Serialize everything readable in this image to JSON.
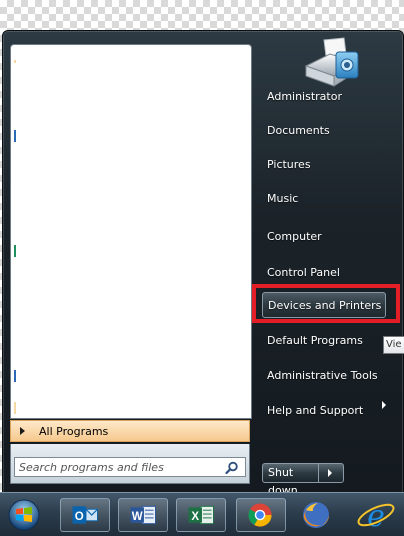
{
  "start_menu": {
    "all_programs_label": "All Programs",
    "search_placeholder": "Search programs and files",
    "right_items": [
      {
        "label": "Administrator",
        "has_submenu": false
      },
      {
        "label": "Documents",
        "has_submenu": false
      },
      {
        "label": "Pictures",
        "has_submenu": false
      },
      {
        "label": "Music",
        "has_submenu": false
      },
      {
        "label": "Computer",
        "has_submenu": false
      },
      {
        "label": "Control Panel",
        "has_submenu": false
      },
      {
        "label": "Devices and Printers",
        "has_submenu": false,
        "highlighted": true
      },
      {
        "label": "Default Programs",
        "has_submenu": false
      },
      {
        "label": "Administrative Tools",
        "has_submenu": true
      },
      {
        "label": "Help and Support",
        "has_submenu": false
      }
    ],
    "shutdown_label": "Shut down",
    "tooltip_text": "Vie",
    "user_picture_icon": "devices-printers-icon"
  },
  "taskbar": {
    "items": [
      {
        "name": "start-orb-icon"
      },
      {
        "name": "outlook-icon",
        "letter": "O"
      },
      {
        "name": "word-icon",
        "letter": "W"
      },
      {
        "name": "excel-icon",
        "letter": "X"
      },
      {
        "name": "chrome-icon"
      },
      {
        "name": "firefox-icon"
      },
      {
        "name": "internet-explorer-icon"
      }
    ]
  },
  "colors": {
    "highlight_box": "#e31e26",
    "all_programs_bg": "#f6c98d",
    "menu_dark": "#1b2329"
  }
}
